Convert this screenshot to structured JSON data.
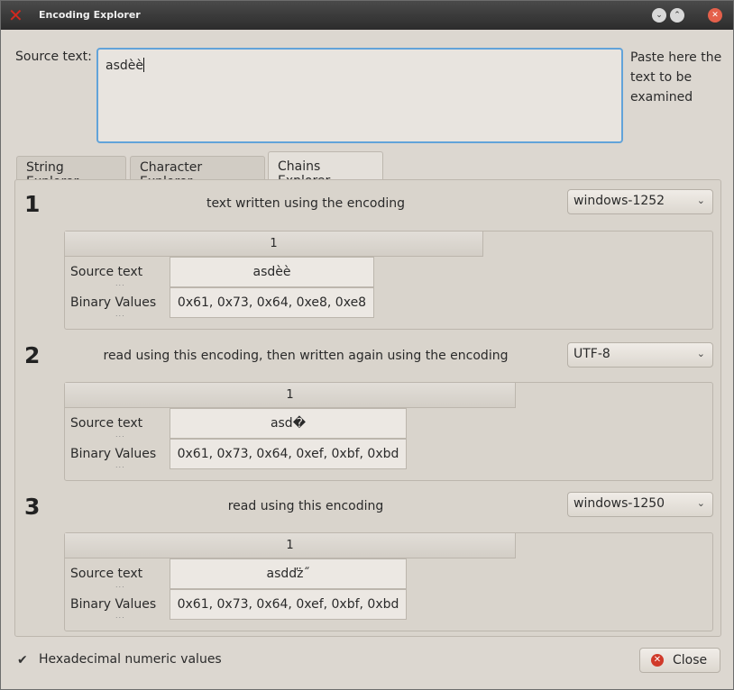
{
  "window": {
    "title": "Encoding Explorer",
    "app_icon": "x-app-icon",
    "buttons": [
      "minimize-icon",
      "maximize-icon",
      "close-icon"
    ]
  },
  "source": {
    "label": "Source text:",
    "value": "asdèè",
    "hint": "Paste here the text to be examined"
  },
  "tabs": [
    {
      "label": "String Explorer"
    },
    {
      "label": "Character Explorer"
    },
    {
      "label": "Chains Explorer"
    }
  ],
  "active_tab": "Chains Explorer",
  "steps": [
    {
      "number": "1",
      "text": "text written using the encoding",
      "encoding": "windows-1252",
      "table": {
        "column": "1",
        "rows": [
          {
            "header": "Source text",
            "dots": "...",
            "value": "asdèè"
          },
          {
            "header": "Binary Values",
            "dots": "...",
            "value": "0x61, 0x73, 0x64, 0xe8, 0xe8"
          }
        ]
      }
    },
    {
      "number": "2",
      "text": "read using this encoding, then written again using the encoding",
      "encoding": "UTF-8",
      "table": {
        "column": "1",
        "rows": [
          {
            "header": "Source text",
            "dots": "...",
            "value": "asd�"
          },
          {
            "header": "Binary Values",
            "dots": "...",
            "value": "0x61, 0x73, 0x64, 0xef, 0xbf, 0xbd"
          }
        ]
      }
    },
    {
      "number": "3",
      "text": "read using this encoding",
      "encoding": "windows-1250",
      "table": {
        "column": "1",
        "rows": [
          {
            "header": "Source text",
            "dots": "...",
            "value": "asdďż˝"
          },
          {
            "header": "Binary Values",
            "dots": "...",
            "value": "0x61, 0x73, 0x64, 0xef, 0xbf, 0xbd"
          }
        ]
      }
    }
  ],
  "footer": {
    "checkbox_label": "Hexadecimal numeric values",
    "checkbox_checked": true,
    "close_label": "Close"
  },
  "colors": {
    "focus_border": "#62a3d9",
    "close_icon": "#d03a2a",
    "app_icon": "#d2281e"
  }
}
